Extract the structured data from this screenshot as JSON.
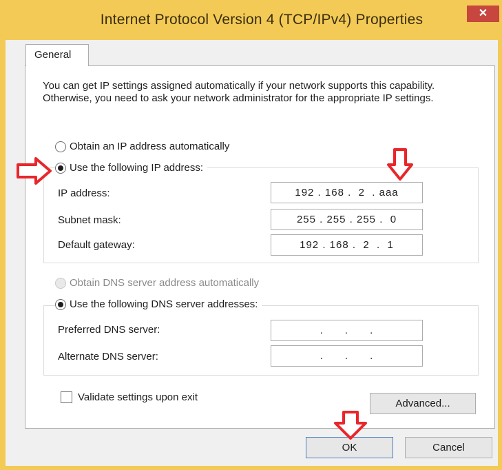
{
  "window": {
    "title": "Internet Protocol Version 4 (TCP/IPv4) Properties",
    "close_label": "✕"
  },
  "tabs": [
    {
      "label": "General"
    }
  ],
  "description": "You can get IP settings assigned automatically if your network supports this capability. Otherwise, you need to ask your network administrator for the appropriate IP settings.",
  "ip_section": {
    "auto_label": "Obtain an IP address automatically",
    "manual_label": "Use the following IP address:",
    "selected": "manual",
    "fields": [
      {
        "label": "IP address:",
        "value": "192 . 168 .  2  . aaa"
      },
      {
        "label": "Subnet mask:",
        "value": "255 . 255 . 255 .  0"
      },
      {
        "label": "Default gateway:",
        "value": "192 . 168 .  2  .  1"
      }
    ]
  },
  "dns_section": {
    "auto_label": "Obtain DNS server address automatically",
    "auto_disabled": true,
    "manual_label": "Use the following DNS server addresses:",
    "selected": "manual",
    "fields": [
      {
        "label": "Preferred DNS server:",
        "value": ".      .      ."
      },
      {
        "label": "Alternate DNS server:",
        "value": ".      .      ."
      }
    ]
  },
  "validate": {
    "label": "Validate settings upon exit",
    "checked": false
  },
  "buttons": {
    "advanced": "Advanced...",
    "ok": "OK",
    "cancel": "Cancel"
  },
  "colors": {
    "title_bar": "#f3ca55",
    "close": "#c7463d",
    "annotation_arrow": "#e8262b"
  },
  "annotations": [
    {
      "icon": "arrow-right-icon",
      "points_to": "Use the following IP address"
    },
    {
      "icon": "arrow-down-icon",
      "points_to": "IP address last octet"
    },
    {
      "icon": "arrow-down-icon",
      "points_to": "OK button"
    }
  ]
}
